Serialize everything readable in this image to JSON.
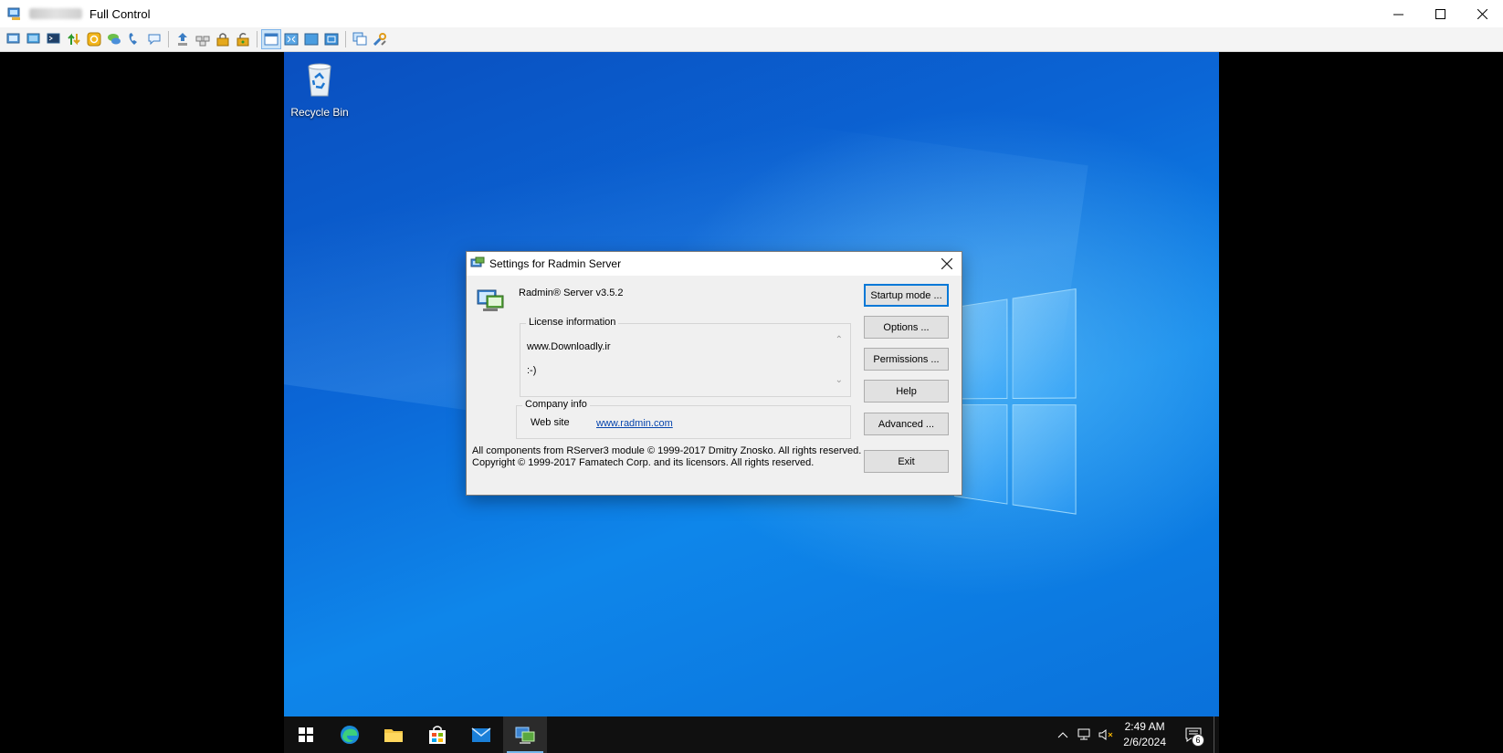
{
  "window": {
    "title": "Full Control"
  },
  "toolbar": {
    "icons": [
      "full-control-icon",
      "view-only-icon",
      "telnet-icon",
      "file-transfer-icon",
      "shutdown-icon",
      "chat-icon",
      "voice-chat-icon",
      "send-message-icon",
      "send-file-icon",
      "ctrl-alt-del-icon",
      "lock-icon",
      "unlock-icon",
      "normal-mode-icon",
      "fullscreen-icon",
      "stretch-icon",
      "fit-icon",
      "window-list-icon",
      "settings-icon"
    ]
  },
  "desktop": {
    "recycle_bin_label": "Recycle Bin"
  },
  "dialog": {
    "title": "Settings for Radmin Server",
    "product_name": "Radmin® Server v3.5.2",
    "license_legend": "License information",
    "license_line1": "www.Downloadly.ir",
    "license_line2": ":-)",
    "company_legend": "Company info",
    "web_site_label": "Web site",
    "web_site_link": "www.radmin.com",
    "footer_line1": "All components from RServer3 module © 1999-2017 Dmitry Znosko. All rights reserved.",
    "footer_line2": "Copyright © 1999-2017 Famatech Corp. and its licensors. All rights reserved.",
    "buttons": {
      "startup_mode": "Startup mode ...",
      "options": "Options ...",
      "permissions": "Permissions ...",
      "help": "Help",
      "advanced": "Advanced ...",
      "exit": "Exit"
    }
  },
  "taskbar": {
    "time": "2:49 AM",
    "date": "2/6/2024",
    "notification_count": "6"
  },
  "colors": {
    "accent": "#0078d7",
    "desktop_blue": "#0b66d6",
    "link": "#0645ad"
  }
}
